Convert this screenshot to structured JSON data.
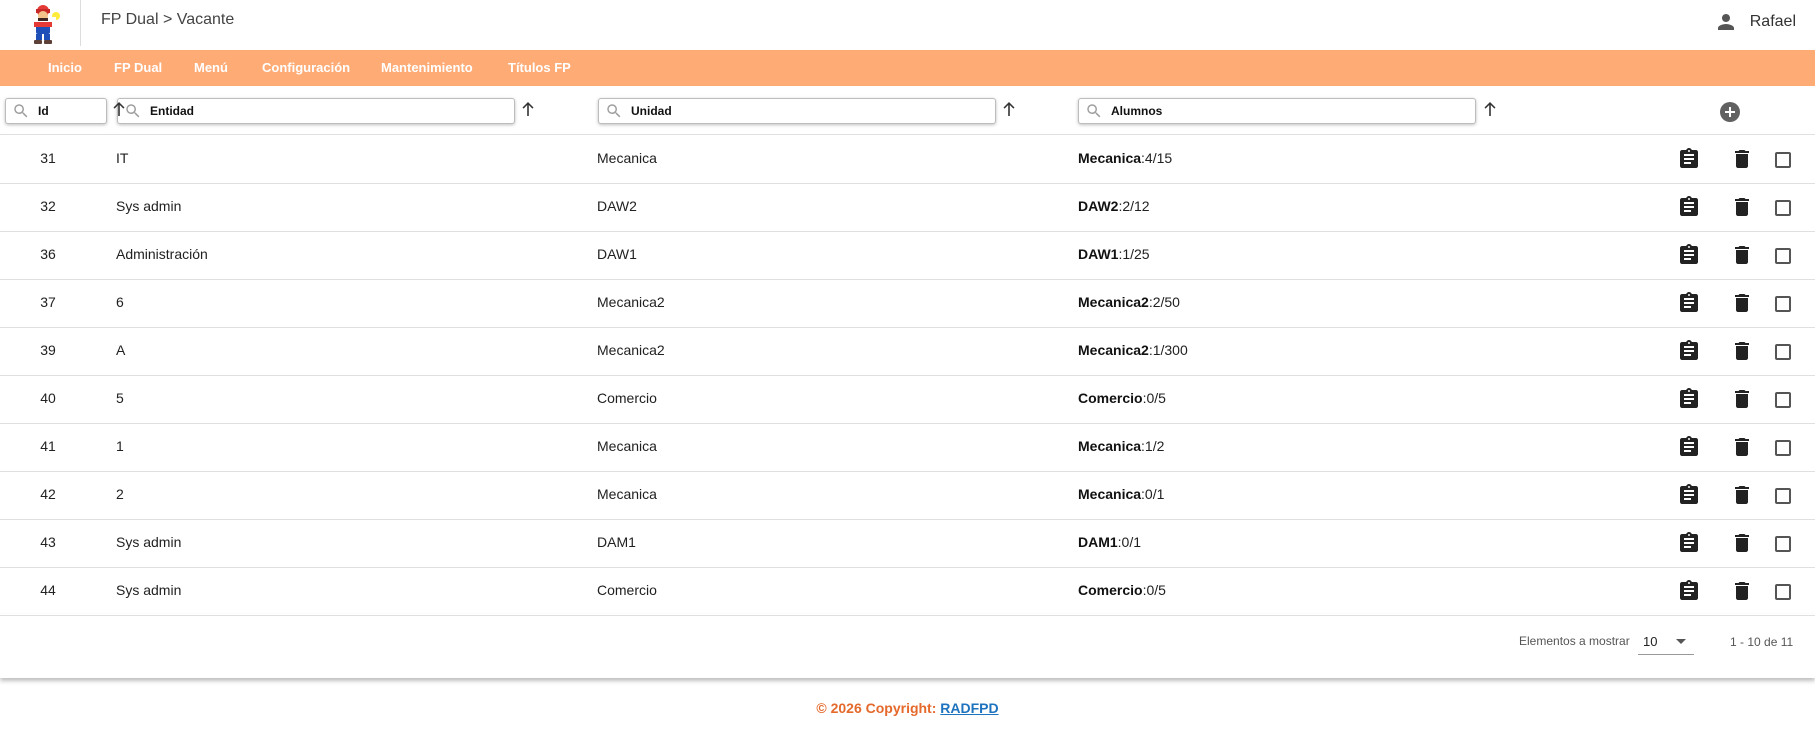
{
  "header": {
    "breadcrumb": "FP Dual > Vacante",
    "user_name": "Rafael",
    "user_icon": "person-icon",
    "logo": "mario-logo"
  },
  "nav": {
    "items": [
      "Inicio",
      "FP Dual",
      "Menú",
      "Configuración",
      "Mantenimiento",
      "Títulos FP"
    ],
    "color": "#ffab76"
  },
  "filters": {
    "id": "Id",
    "entidad": "Entidad",
    "unidad": "Unidad",
    "alumnos": "Alumnos"
  },
  "rows": [
    {
      "id": "31",
      "entidad": "IT",
      "unidad": "Mecanica",
      "alumnos_unit": "Mecanica",
      "alumnos_count": ":4/15"
    },
    {
      "id": "32",
      "entidad": "Sys admin",
      "unidad": "DAW2",
      "alumnos_unit": "DAW2",
      "alumnos_count": ":2/12"
    },
    {
      "id": "36",
      "entidad": "Administración",
      "unidad": "DAW1",
      "alumnos_unit": "DAW1",
      "alumnos_count": ":1/25"
    },
    {
      "id": "37",
      "entidad": "6",
      "unidad": "Mecanica2",
      "alumnos_unit": "Mecanica2",
      "alumnos_count": ":2/50"
    },
    {
      "id": "39",
      "entidad": "A",
      "unidad": "Mecanica2",
      "alumnos_unit": "Mecanica2",
      "alumnos_count": ":1/300"
    },
    {
      "id": "40",
      "entidad": "5",
      "unidad": "Comercio",
      "alumnos_unit": "Comercio",
      "alumnos_count": ":0/5"
    },
    {
      "id": "41",
      "entidad": "1",
      "unidad": "Mecanica",
      "alumnos_unit": "Mecanica",
      "alumnos_count": ":1/2"
    },
    {
      "id": "42",
      "entidad": "2",
      "unidad": "Mecanica",
      "alumnos_unit": "Mecanica",
      "alumnos_count": ":0/1"
    },
    {
      "id": "43",
      "entidad": "Sys admin",
      "unidad": "DAM1",
      "alumnos_unit": "DAM1",
      "alumnos_count": ":0/1"
    },
    {
      "id": "44",
      "entidad": "Sys admin",
      "unidad": "Comercio",
      "alumnos_unit": "Comercio",
      "alumnos_count": ":0/5"
    }
  ],
  "row_actions": [
    "clipboard-icon",
    "trash-icon",
    "checkbox"
  ],
  "paginator": {
    "label": "Elementos a mostrar",
    "page_size": "10",
    "range": "1 - 10 de 11"
  },
  "footer": {
    "text": "© 2026 Copyright: ",
    "link": "RADFPD",
    "text_color": "#e4692b",
    "link_color": "#1e73be"
  }
}
